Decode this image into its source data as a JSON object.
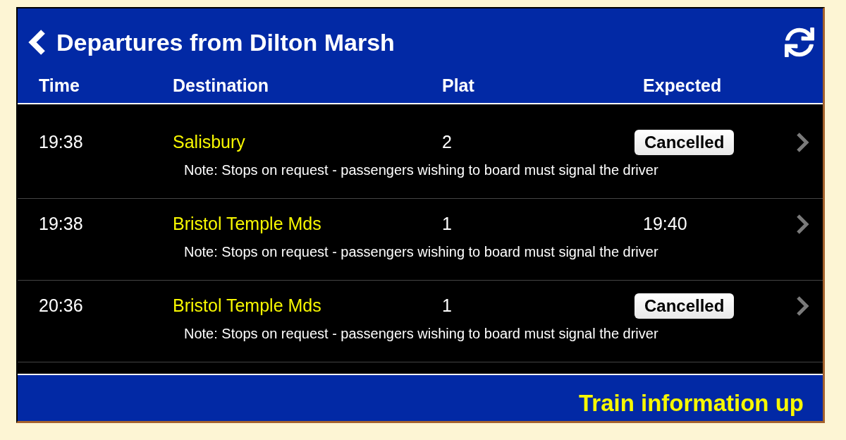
{
  "header": {
    "title": "Departures from Dilton Marsh"
  },
  "columns": [
    "Time",
    "Destination",
    "Plat",
    "Expected"
  ],
  "departures": [
    {
      "time": "19:38",
      "destination": "Salisbury",
      "platform": "2",
      "expected": {
        "kind": "badge",
        "text": "Cancelled"
      },
      "note": "Note: Stops on request - passengers wishing to board must signal the driver"
    },
    {
      "time": "19:38",
      "destination": "Bristol Temple Mds",
      "platform": "1",
      "expected": {
        "kind": "time",
        "text": "19:40"
      },
      "note": "Note: Stops on request - passengers wishing to board must signal the driver"
    },
    {
      "time": "20:36",
      "destination": "Bristol Temple Mds",
      "platform": "1",
      "expected": {
        "kind": "badge",
        "text": "Cancelled"
      },
      "note": "Note: Stops on request - passengers wishing to board must signal the driver"
    }
  ],
  "footer": {
    "text": "Train information up"
  }
}
